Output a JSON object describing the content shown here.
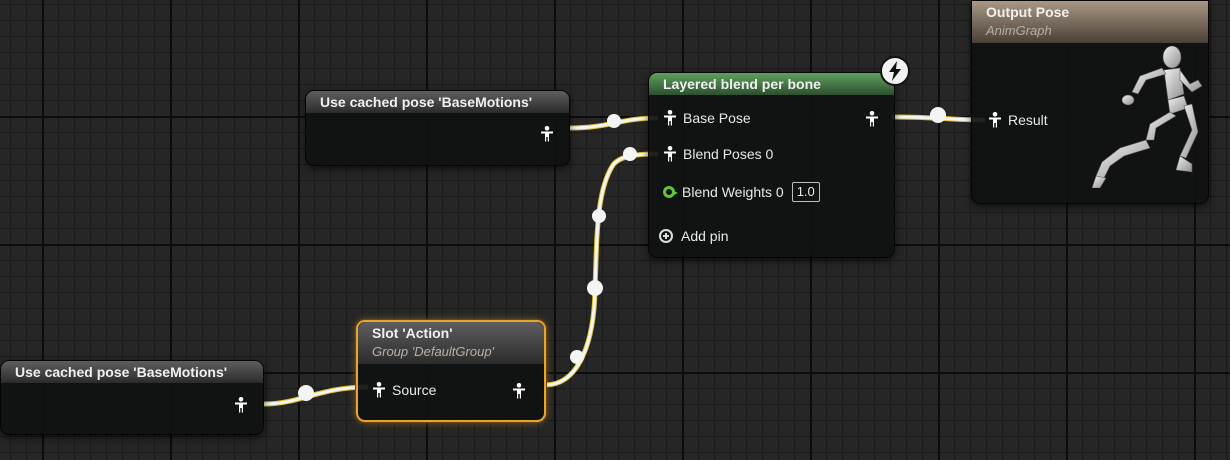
{
  "nodes": {
    "cached_pose_top": {
      "title": "Use cached pose 'BaseMotions'"
    },
    "cached_pose_bottom": {
      "title": "Use cached pose 'BaseMotions'"
    },
    "slot": {
      "title": "Slot 'Action'",
      "subtitle": "Group 'DefaultGroup'",
      "pin_source": "Source"
    },
    "layered_blend": {
      "title": "Layered blend per bone",
      "pin_base_pose": "Base Pose",
      "pin_blend_poses": "Blend Poses 0",
      "pin_blend_weights": "Blend Weights 0",
      "blend_weight_value": "1.0",
      "add_pin": "Add pin"
    },
    "output_pose": {
      "title": "Output Pose",
      "subtitle": "AnimGraph",
      "pin_result": "Result"
    }
  },
  "icons": {
    "pose_pin": "pose-person-icon",
    "float_pin": "float-pin-icon",
    "add": "plus-circle-icon",
    "fast_path": "lightning-icon",
    "preview": "mannequin-icon"
  },
  "colors": {
    "wire": "#f4f4f4",
    "wire_edge": "#e0c331",
    "selection": "#e7a431",
    "blend_header": "#4f8a50",
    "output_header": "#8a7a68",
    "float_pin": "#62c43a"
  }
}
